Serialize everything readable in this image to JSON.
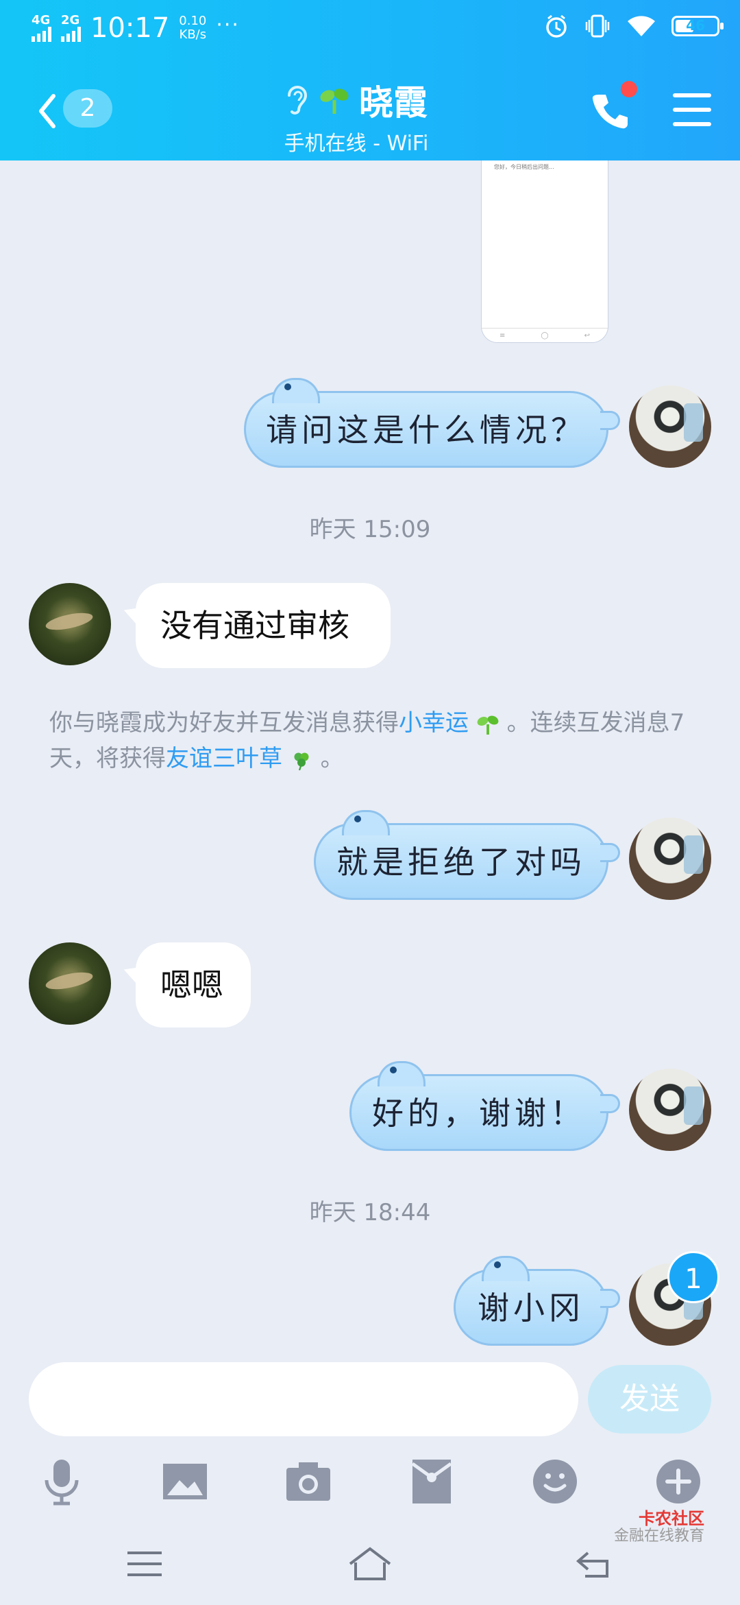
{
  "status_bar": {
    "network": "4G",
    "network2": "2G",
    "time": "10:17",
    "speed_value": "0.10",
    "speed_unit": "KB/s",
    "more": "···",
    "battery": "46"
  },
  "header": {
    "unread_count": "2",
    "contact_name": "晓霞",
    "subtitle": "手机在线 - WiFi"
  },
  "messages": [
    {
      "side": "me",
      "text": "请问这是什么情况？"
    },
    {
      "timestamp": "昨天 15:09"
    },
    {
      "side": "other",
      "text": "没有通过审核"
    },
    {
      "system": true,
      "text_before": "你与晓霞成为好友并互发消息获得",
      "link1": "小幸运",
      "text_mid": "。连续互发消息7天，将获得",
      "link2": "友谊三叶草",
      "text_after": "。"
    },
    {
      "side": "me",
      "text": "就是拒绝了对吗"
    },
    {
      "side": "other",
      "text": "嗯嗯"
    },
    {
      "side": "me",
      "text": "好的，谢谢！"
    },
    {
      "timestamp": "昨天 18:44"
    },
    {
      "side": "me",
      "text": "谢小冈"
    }
  ],
  "screenshot_thumb": {
    "text": "您好，今日稍后出问题..."
  },
  "unread_badge": "1",
  "input": {
    "placeholder": "",
    "send_label": "发送"
  },
  "toolbar": [
    "mic-icon",
    "image-icon",
    "camera-icon",
    "red-packet-icon",
    "emoji-icon",
    "plus-icon"
  ],
  "watermark": {
    "line1": "卡农社区",
    "line2": "金融在线教育"
  },
  "colors": {
    "header": "#1ab6fa",
    "link": "#2f9cf2",
    "bubble_me": "#a9d8fa",
    "send_disabled": "#c8eaf8"
  }
}
